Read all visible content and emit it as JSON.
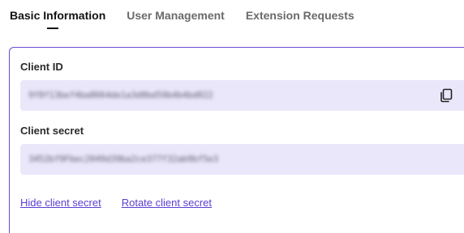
{
  "tabs": [
    {
      "label": "Basic Information",
      "active": true
    },
    {
      "label": "User Management",
      "active": false
    },
    {
      "label": "Extension Requests",
      "active": false
    }
  ],
  "client_id": {
    "label": "Client ID",
    "value": "9f8f13bef4ba8664de1a3d0bd59b4b4bd022",
    "copy_icon": "copy-icon"
  },
  "client_secret": {
    "label": "Client secret",
    "value": "3452bf9Fbec2049d39ba2ce377f32ab9bf5e3"
  },
  "links": {
    "hide_secret": "Hide client secret",
    "rotate_secret": "Rotate client secret"
  },
  "colors": {
    "accent": "#5b3fd1",
    "field_bg": "#ebe7fb",
    "panel_border": "#6b4ad3"
  }
}
